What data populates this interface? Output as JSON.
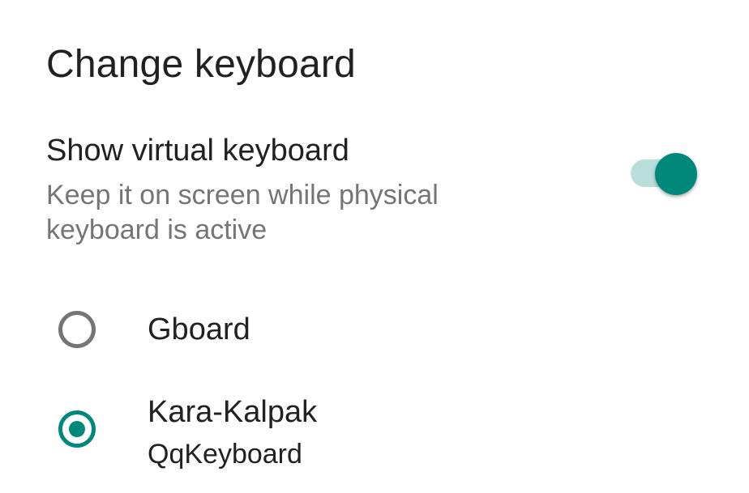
{
  "dialog": {
    "title": "Change keyboard"
  },
  "virtual_keyboard": {
    "title": "Show virtual keyboard",
    "summary": "Keep it on screen while physical keyboard is active",
    "enabled": true,
    "accent_color": "#00897b"
  },
  "keyboards": [
    {
      "name": "Gboard",
      "subtitle": "",
      "selected": false
    },
    {
      "name": "Kara-Kalpak",
      "subtitle": "QqKeyboard",
      "selected": true
    }
  ]
}
